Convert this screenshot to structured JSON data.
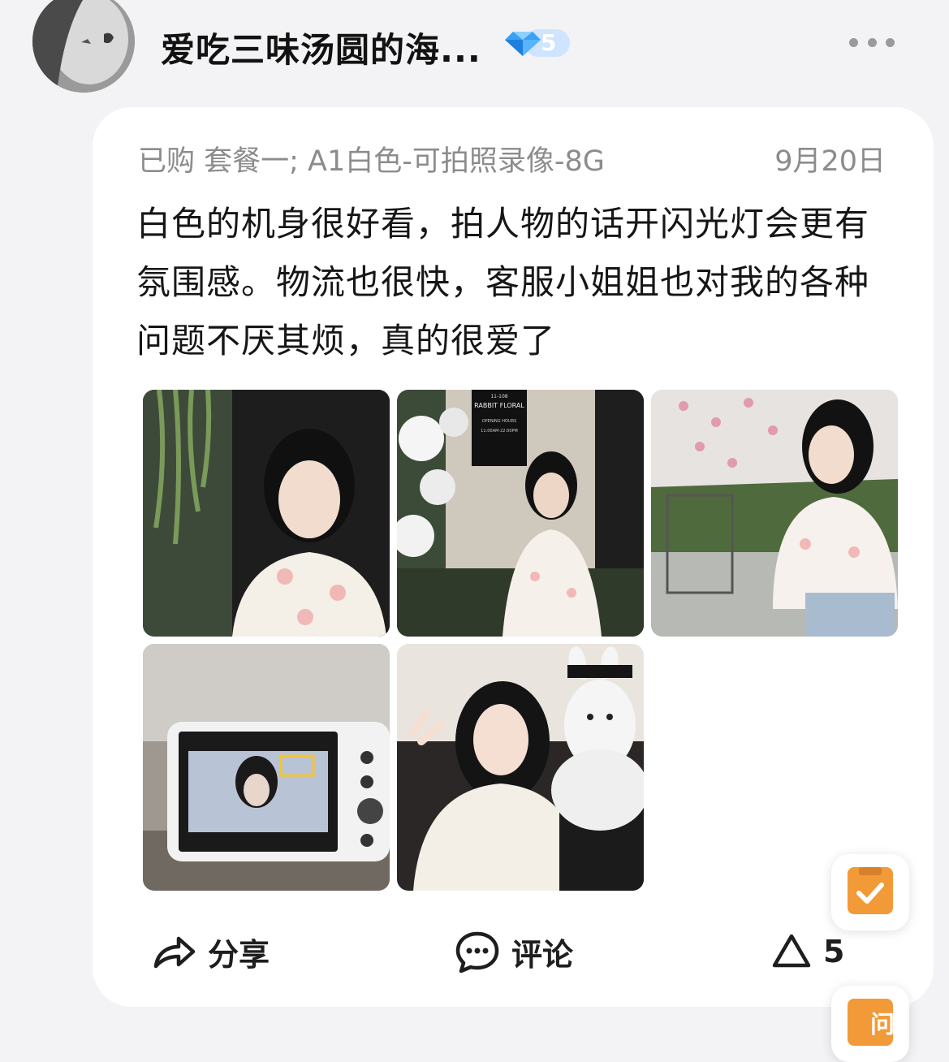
{
  "user": {
    "name": "爱吃三味汤圆的海...",
    "level_badge": "5"
  },
  "review": {
    "purchase_spec": "已购 套餐一; A1白色-可拍照录像-8G",
    "date": "9月20日",
    "text": "白色的机身很好看，拍人物的话开闪光灯会更有氛围感。物流也很快，客服小姐姐也对我的各种问题不厌其烦，真的很爱了",
    "photos": [
      {
        "scene": "portrait-dark-doorway",
        "sign_lines": []
      },
      {
        "scene": "portrait-flower-shop",
        "sign_lines": [
          "11-108",
          "RABBIT FLORAL",
          "OPENING HOURS",
          "11:00AM-22:00PM"
        ]
      },
      {
        "scene": "portrait-pink-flowers",
        "sign_lines": []
      },
      {
        "scene": "camera-screen-preview",
        "sign_lines": []
      },
      {
        "scene": "peace-sign-with-bunny-plush",
        "sign_lines": []
      }
    ]
  },
  "actions": {
    "share_label": "分享",
    "comment_label": "评论",
    "like_count": "5"
  },
  "floating": {
    "second_label": "问"
  },
  "colors": {
    "background": "#f3f3f5",
    "card": "#ffffff",
    "meta_text": "#8c8c8c",
    "badge": "#cfe4ff",
    "float_accent": "#f29a38"
  }
}
